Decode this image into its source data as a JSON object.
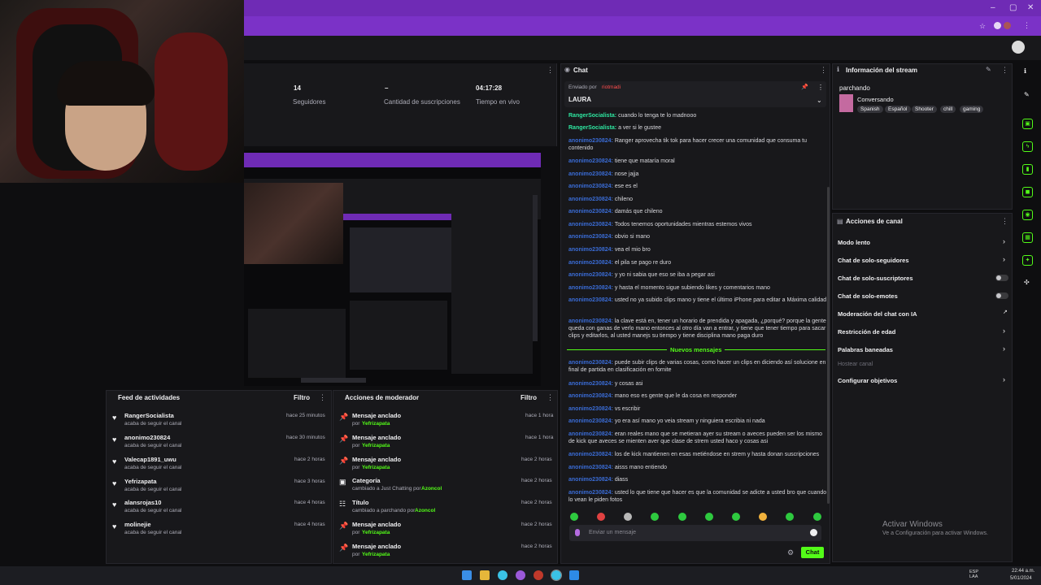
{
  "window": {
    "minimize": "–",
    "maximize": "▢",
    "close": "✕"
  },
  "stats": [
    {
      "value": "14",
      "label": "Seguidores"
    },
    {
      "value": "–",
      "label": "Cantidad de suscripciones"
    },
    {
      "value": "04:17:28",
      "label": "Tiempo en vivo"
    }
  ],
  "chat": {
    "title": "Chat",
    "pinned_label": "Enviado por",
    "pinned_by": "riotmadi",
    "pinned_text": "LAURA",
    "new_messages": "Nuevos mensajes",
    "input_placeholder": "Enviar un mensaje",
    "send_label": "Chat",
    "messages_before": [
      {
        "user": "RangerSocialista:",
        "text": "cuando lo tenga te lo madnooo",
        "style": "u2"
      },
      {
        "user": "RangerSocialista:",
        "text": "a ver si le gustee",
        "style": "u2"
      },
      {
        "user": "anonimo230824:",
        "text": "Ranger aprovecha tik tok para hacer crecer una comunidad que consuma tu contenido",
        "style": "u"
      },
      {
        "user": "anonimo230824:",
        "text": "tiene que mataría moral",
        "style": "u"
      },
      {
        "user": "anonimo230824:",
        "text": "nose jajja",
        "style": "u"
      },
      {
        "user": "anonimo230824:",
        "text": "ese es el",
        "style": "u"
      },
      {
        "user": "anonimo230824:",
        "text": "chileno",
        "style": "u"
      },
      {
        "user": "anonimo230824:",
        "text": "damás que chileno",
        "style": "u"
      },
      {
        "user": "anonimo230824:",
        "text": "Todos tenemos oportunidades mientras estemos vivos",
        "style": "u"
      },
      {
        "user": "anonimo230824:",
        "text": "obvio si mano",
        "style": "u"
      },
      {
        "user": "anonimo230824:",
        "text": "vea el mio bro",
        "style": "u"
      },
      {
        "user": "anonimo230824:",
        "text": "el pila se pago re duro",
        "style": "u"
      },
      {
        "user": "anonimo230824:",
        "text": "y yo ni sabia que eso se iba a pegar asi",
        "style": "u"
      },
      {
        "user": "anonimo230824:",
        "text": "y hasta el momento sigue subiendo likes y comentarios mano",
        "style": "u"
      },
      {
        "user": "anonimo230824:",
        "text": "usted no ya subido clips mano y tiene el último iPhone para editar a Máxima calidad",
        "style": "u"
      },
      {
        "user": "anonimo230824:",
        "text": "la clave está en, tener un horario de prendida y apagada, ¿porqué? porque la gente queda con ganas de verlo mano entonces al otro día van a entrar, y tiene que tener tiempo para sacar clips y editarlos, al usted manejs su tiempo y tiene disciplina mano paga duro",
        "style": "u"
      }
    ],
    "messages_after": [
      {
        "user": "anonimo230824:",
        "text": "puede subir clips de varias cosas, como hacer un clips en diciendo así solucione en final de partida en clasificación en fornite",
        "style": "u"
      },
      {
        "user": "anonimo230824:",
        "text": "y cosas asi",
        "style": "u"
      },
      {
        "user": "anonimo230824:",
        "text": "mano eso es gente que le da cosa en responder",
        "style": "u"
      },
      {
        "user": "anonimo230824:",
        "text": "vs escribir",
        "style": "u"
      },
      {
        "user": "anonimo230824:",
        "text": "yo era así mano yo veia stream y ninguiera escribia ni nada",
        "style": "u"
      },
      {
        "user": "anonimo230824:",
        "text": "eran reales mano que se metieran ayer su stream o aveces pueden ser los mismo de kick que aveces se mienten aver que clase de strem usted haco y cosas asi",
        "style": "u"
      },
      {
        "user": "anonimo230824:",
        "text": "los de kick mantienen en esas metiéndose en strem y hasta donan suscripciones",
        "style": "u"
      },
      {
        "user": "anonimo230824:",
        "text": "aisss mano entiendo",
        "style": "u"
      },
      {
        "user": "anonimo230824:",
        "text": "diass",
        "style": "u"
      },
      {
        "user": "anonimo230824:",
        "text": "usted lo que tiene que hacer es que la comunidad se adicte a usted bro que cuando lo vean le piden fotos",
        "style": "u"
      }
    ]
  },
  "stream_info": {
    "title": "Información del stream",
    "stream_title": "parchando",
    "category": "Conversando",
    "tags": [
      "Spanish",
      "Español",
      "Shooter",
      "chill",
      "gaming"
    ]
  },
  "channel_actions": {
    "title": "Acciones de canal",
    "items": [
      {
        "label": "Modo lento",
        "control": "arrow"
      },
      {
        "label": "Chat de solo-seguidores",
        "control": "arrow"
      },
      {
        "label": "Chat de solo-suscriptores",
        "control": "toggle"
      },
      {
        "label": "Chat de solo-emotes",
        "control": "toggle"
      },
      {
        "label": "Moderación del chat con IA",
        "control": "ext"
      },
      {
        "label": "Restricción de edad",
        "control": "arrow"
      },
      {
        "label": "Palabras baneadas",
        "control": "arrow"
      },
      {
        "label": "Hostear canal",
        "control": "none"
      },
      {
        "label": "Configurar objetivos",
        "control": "arrow"
      }
    ]
  },
  "activity": {
    "title": "Feed de actividades",
    "filter": "Filtro",
    "items": [
      {
        "name": "RangerSocialista",
        "sub": "acaba de seguir el canal",
        "time": "hace 25 minutos"
      },
      {
        "name": "anonimo230824",
        "sub": "acaba de seguir el canal",
        "time": "hace 30 minutos"
      },
      {
        "name": "Valecap1891_uwu",
        "sub": "acaba de seguir el canal",
        "time": "hace 2 horas"
      },
      {
        "name": "Yefrizapata",
        "sub": "acaba de seguir el canal",
        "time": "hace 3 horas"
      },
      {
        "name": "alansrojas10",
        "sub": "acaba de seguir el canal",
        "time": "hace 4 horas"
      },
      {
        "name": "molinejie",
        "sub": "acaba de seguir el canal",
        "time": "hace 4 horas"
      }
    ]
  },
  "mod_actions": {
    "title": "Acciones de moderador",
    "filter": "Filtro",
    "items": [
      {
        "title": "Mensaje anclado",
        "sub_prefix": "por",
        "sub_user": "Yefrizapata",
        "time": "hace 1 hora"
      },
      {
        "title": "Mensaje anclado",
        "sub_prefix": "por",
        "sub_user": "Yefrizapata",
        "time": "hace 1 hora"
      },
      {
        "title": "Mensaje anclado",
        "sub_prefix": "por",
        "sub_user": "Yefrizapata",
        "time": "hace 2 horas"
      },
      {
        "title": "Categoría",
        "sub_prefix": "cambiado a Just Chatting por",
        "sub_user": "Azoncol",
        "time": "hace 2 horas"
      },
      {
        "title": "Título",
        "sub_prefix": "cambiado a parchando por",
        "sub_user": "Azoncol",
        "time": "hace 2 horas"
      },
      {
        "title": "Mensaje anclado",
        "sub_prefix": "por",
        "sub_user": "Yefrizapata",
        "time": "hace 2 horas"
      },
      {
        "title": "Mensaje anclado",
        "sub_prefix": "por",
        "sub_user": "Yefrizapata",
        "time": "hace 2 horas"
      }
    ]
  },
  "watermark": {
    "line1": "Activar Windows",
    "line2": "Ve a Configuración para activar Windows."
  },
  "taskbar": {
    "lang": "ESP LAA",
    "time": "22:44 a.m.",
    "date": "5/01/2024"
  }
}
